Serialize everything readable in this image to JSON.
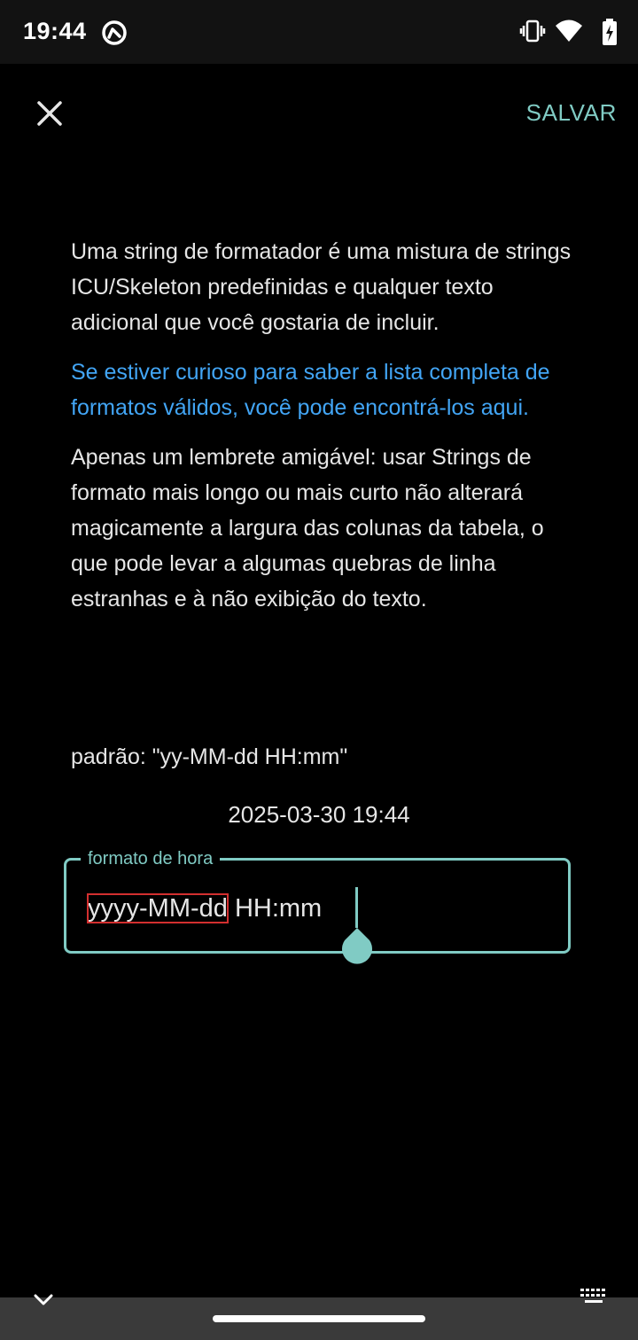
{
  "status_bar": {
    "time": "19:44",
    "left_icon": "do-not-disturb-icon",
    "right_icons": [
      "vibrate-icon",
      "wifi-icon",
      "battery-charging-icon"
    ]
  },
  "app_bar": {
    "close_icon": "close-icon",
    "save_label": "SALVAR"
  },
  "content": {
    "paragraph_1": "Uma string de formatador é uma mistura de strings ICU/Skeleton predefinidas e qualquer texto adicional que você gostaria de incluir.",
    "link_text": "Se estiver curioso para saber a lista completa de formatos válidos, você pode encontrá-los aqui.",
    "paragraph_2": "Apenas um lembrete amigável: usar Strings de formato mais longo ou mais curto não alterará magicamente a largura das colunas da tabela, o que pode levar a algumas quebras de linha estranhas e à não exibição do texto.",
    "default_text": "padrão: \"yy-MM-dd HH:mm\"",
    "preview_value": "2025-03-30 19:44"
  },
  "field": {
    "label": "formato de hora",
    "value_highlighted": "yyyy-MM-dd",
    "value_rest": " HH:mm"
  },
  "nav": {
    "hide_keyboard_icon": "chevron-down-icon",
    "keyboard_icon": "keyboard-icon"
  },
  "colors": {
    "accent": "#80cbc4",
    "link": "#42a5f5",
    "background": "#000000",
    "highlight": "#d32f2f"
  }
}
